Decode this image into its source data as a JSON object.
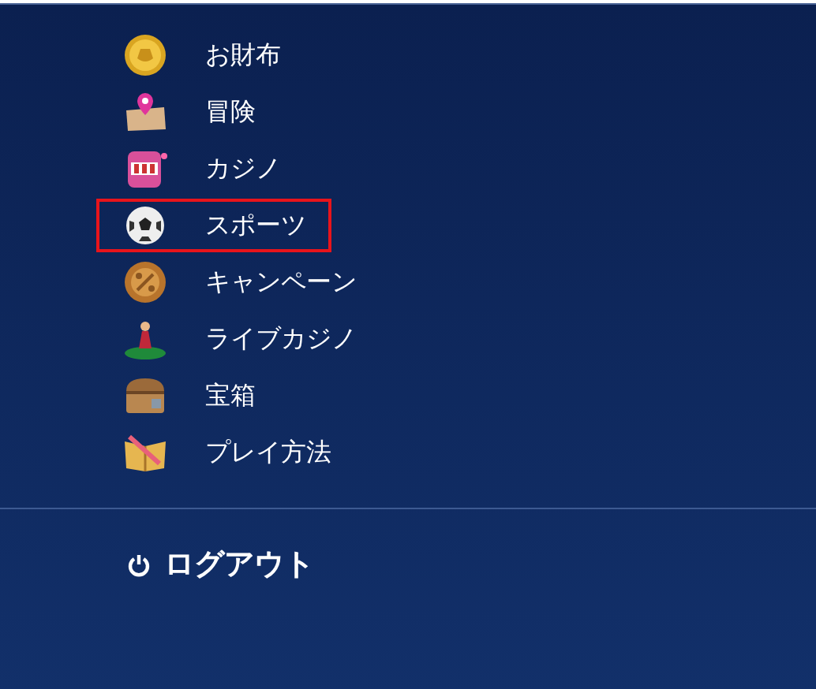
{
  "menu": {
    "items": [
      {
        "label": "お財布",
        "kind": "coin",
        "selected": false
      },
      {
        "label": "冒険",
        "kind": "map",
        "selected": false
      },
      {
        "label": "カジノ",
        "kind": "slot",
        "selected": false
      },
      {
        "label": "スポーツ",
        "kind": "ball",
        "selected": true
      },
      {
        "label": "キャンペーン",
        "kind": "badge",
        "selected": false
      },
      {
        "label": "ライブカジノ",
        "kind": "dealer",
        "selected": false
      },
      {
        "label": "宝箱",
        "kind": "chest",
        "selected": false
      },
      {
        "label": "プレイ方法",
        "kind": "book",
        "selected": false
      }
    ]
  },
  "logout": {
    "label": "ログアウト"
  }
}
